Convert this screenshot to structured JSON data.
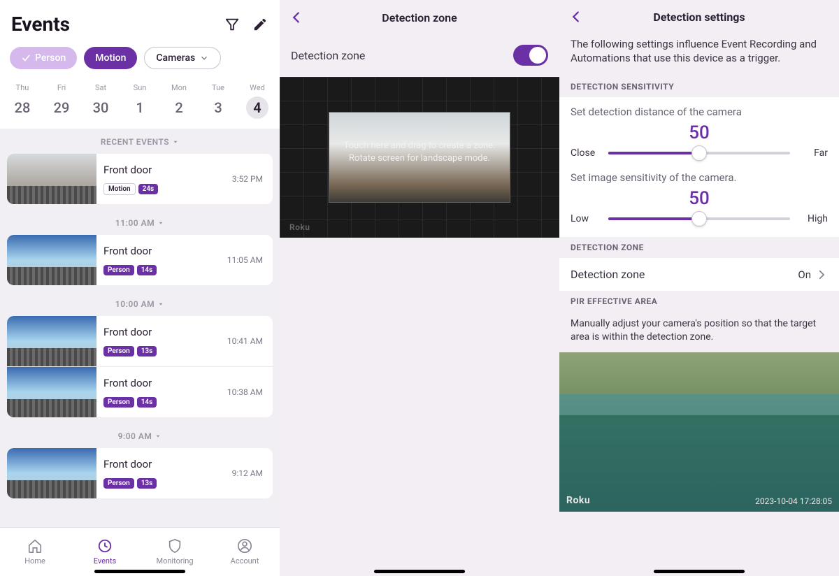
{
  "panel1": {
    "title": "Events",
    "pills": {
      "person": "Person",
      "motion": "Motion",
      "cameras": "Cameras"
    },
    "days": [
      {
        "dow": "Thu",
        "num": "28"
      },
      {
        "dow": "Fri",
        "num": "29"
      },
      {
        "dow": "Sat",
        "num": "30"
      },
      {
        "dow": "Sun",
        "num": "1"
      },
      {
        "dow": "Mon",
        "num": "2"
      },
      {
        "dow": "Tue",
        "num": "3"
      },
      {
        "dow": "Wed",
        "num": "4",
        "selected": true
      }
    ],
    "recent_label": "RECENT EVENTS",
    "sections": [
      {
        "head": null,
        "events": [
          {
            "title": "Front door",
            "tag_type": "Motion",
            "duration": "24s",
            "time": "3:52 PM",
            "thumb": "cloudy"
          }
        ]
      },
      {
        "head": "11:00 AM",
        "events": [
          {
            "title": "Front door",
            "tag_type": "Person",
            "duration": "14s",
            "time": "11:05 AM",
            "thumb": "sky"
          }
        ]
      },
      {
        "head": "10:00 AM",
        "events": [
          {
            "title": "Front door",
            "tag_type": "Person",
            "duration": "13s",
            "time": "10:41 AM",
            "thumb": "sky"
          },
          {
            "title": "Front door",
            "tag_type": "Person",
            "duration": "14s",
            "time": "10:38 AM",
            "thumb": "sky"
          }
        ]
      },
      {
        "head": "9:00 AM",
        "events": [
          {
            "title": "Front door",
            "tag_type": "Person",
            "duration": "13s",
            "time": "9:12 AM",
            "thumb": "sky"
          }
        ]
      }
    ],
    "tabs": {
      "home": "Home",
      "events": "Events",
      "monitoring": "Monitoring",
      "account": "Account"
    }
  },
  "panel2": {
    "title": "Detection zone",
    "toggle_label": "Detection zone",
    "toggle_on": true,
    "hint_line1": "Touch here and drag to create a zone.",
    "hint_line2": "Rotate screen for landscape mode.",
    "watermark": "Roku"
  },
  "panel3": {
    "title": "Detection settings",
    "intro": "The following settings influence Event Recording and Automations that use this device as a trigger.",
    "sensitivity_head": "DETECTION SENSITIVITY",
    "distance_label": "Set detection distance of the camera",
    "distance_value": "50",
    "distance_left": "Close",
    "distance_right": "Far",
    "image_label": "Set image sensitivity of the camera.",
    "image_value": "50",
    "image_left": "Low",
    "image_right": "High",
    "zone_head": "DETECTION ZONE",
    "zone_row_label": "Detection zone",
    "zone_row_value": "On",
    "pir_head": "PIR EFFECTIVE AREA",
    "pir_desc": "Manually adjust your camera's position so that the target area is within the detection zone.",
    "pir_watermark": "Roku",
    "pir_timestamp": "2023-10-04  17:28:05"
  }
}
